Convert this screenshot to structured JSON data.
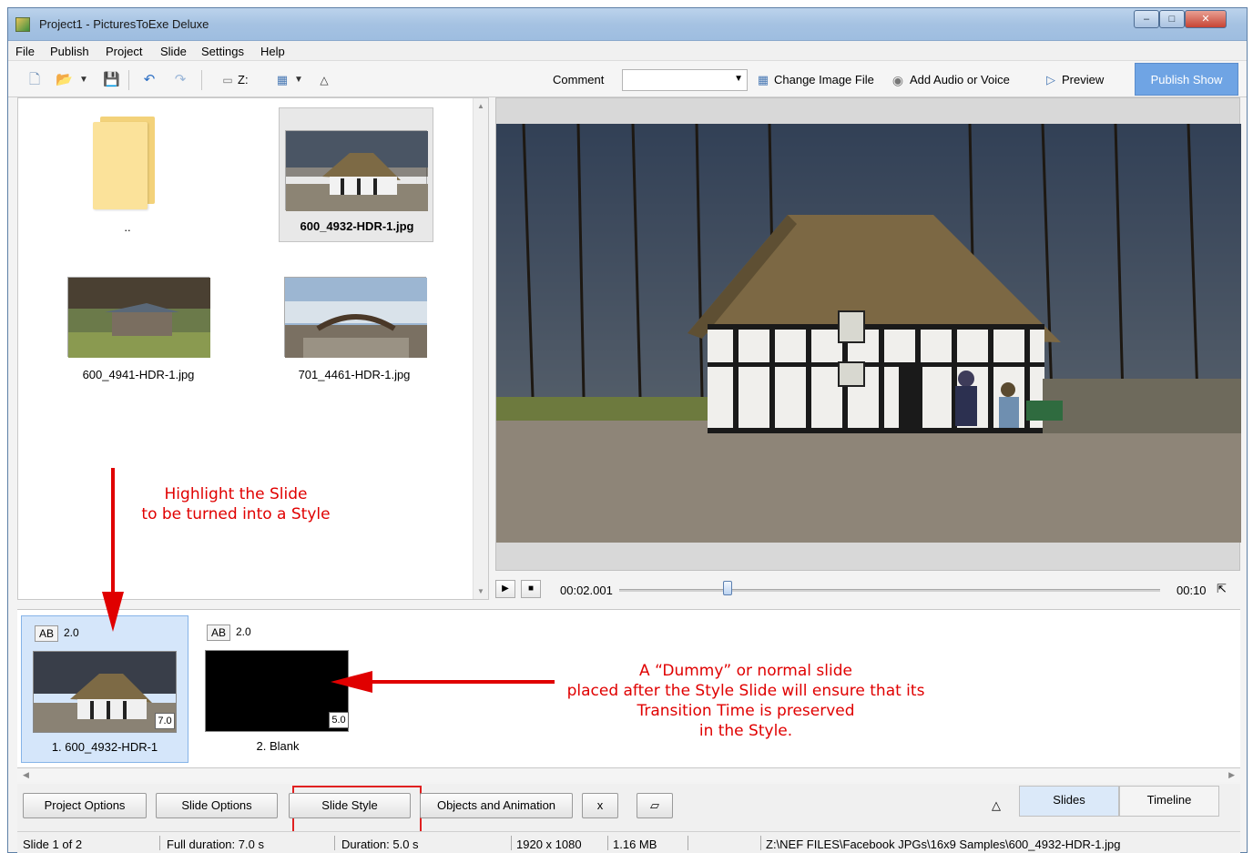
{
  "window": {
    "title": "Project1 - PicturesToExe Deluxe"
  },
  "menu": [
    "File",
    "Publish",
    "Project",
    "Slide",
    "Settings",
    "Help"
  ],
  "toolbar": {
    "drive_label": "Z:",
    "comment_label": "Comment",
    "comment_value": "",
    "change_image": "Change Image File",
    "add_audio": "Add Audio or Voice",
    "preview": "Preview",
    "publish": "Publish Show",
    "icons": [
      "new-file-icon",
      "open-folder-icon",
      "save-icon",
      "undo-icon",
      "redo-icon",
      "drive-icon",
      "view-mode-icon",
      "collapse-triangle-icon"
    ]
  },
  "browser": {
    "items": [
      {
        "name": "..",
        "kind": "folder"
      },
      {
        "name": "600_4932-HDR-1.jpg",
        "kind": "image",
        "selected": true
      },
      {
        "name": "600_4941-HDR-1.jpg",
        "kind": "image"
      },
      {
        "name": "701_4461-HDR-1.jpg",
        "kind": "image"
      }
    ]
  },
  "player": {
    "current_time": "00:02.001",
    "end_time": "00:10",
    "progress": 0.2
  },
  "slides": [
    {
      "label": "1. 600_4932-HDR-1",
      "ab": "AB",
      "transition": "2.0",
      "duration": "7.0",
      "selected": true
    },
    {
      "label": "2. Blank",
      "ab": "AB",
      "transition": "2.0",
      "duration": "5.0",
      "selected": false
    }
  ],
  "buttons": {
    "project_options": "Project Options",
    "slide_options": "Slide Options",
    "slide_style": "Slide Style",
    "objects_animation": "Objects and Animation",
    "x": "x",
    "triangle": "△",
    "tab_slides": "Slides",
    "tab_timeline": "Timeline"
  },
  "status": {
    "slide": "Slide 1 of 2",
    "full_duration": "Full duration: 7.0 s",
    "duration": "Duration: 5.0 s",
    "resolution": "1920 x 1080",
    "size": "1.16 MB",
    "path": "Z:\\NEF FILES\\Facebook JPGs\\16x9 Samples\\600_4932-HDR-1.jpg"
  },
  "annotations": {
    "highlight_line1": "Highlight the Slide",
    "highlight_line2": "to be turned into a Style",
    "dummy_line1": "A “Dummy” or normal slide",
    "dummy_line2": "placed after the Style Slide will ensure that its",
    "dummy_line3": "Transition Time is preserved",
    "dummy_line4": "in the Style.",
    "color": "#e00000"
  }
}
